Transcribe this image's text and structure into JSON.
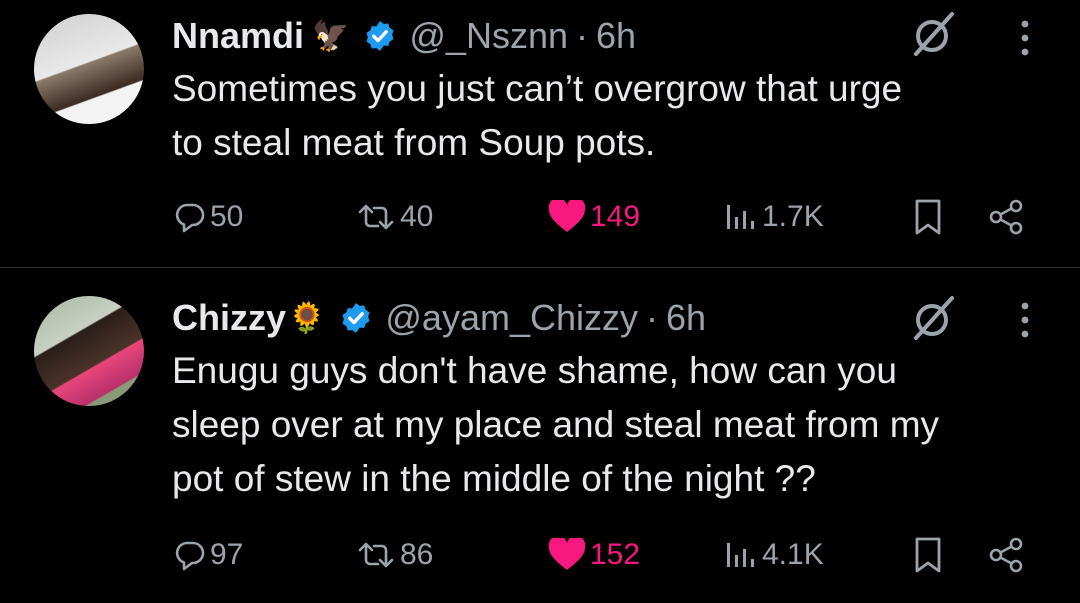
{
  "tweets": [
    {
      "name": "Nnamdi",
      "emoji": "🦅",
      "handle": "@_Nsznn",
      "separator": "·",
      "time": "6h",
      "text_lines": [
        "Sometimes you just can’t overgrow that urge",
        "to steal meat from Soup pots."
      ],
      "replies": "50",
      "retweets": "40",
      "likes": "149",
      "views": "1.7K"
    },
    {
      "name": "Chizzy",
      "emoji": "🌻",
      "handle": "@ayam_Chizzy",
      "separator": "·",
      "time": "6h",
      "text_lines": [
        "Enugu guys don't have shame, how can you",
        "sleep over at my place and steal meat from my",
        "pot of stew in the middle of the night ??"
      ],
      "replies": "97",
      "retweets": "86",
      "likes": "152",
      "views": "4.1K"
    }
  ],
  "colors": {
    "background": "#000000",
    "text": "#e7e9ea",
    "muted": "#9ba3ab",
    "like": "#f91880",
    "verified": "#1d9bf0",
    "divider": "#2f3336"
  },
  "icons": [
    "verified-badge-icon",
    "grok-icon",
    "more-icon",
    "reply-icon",
    "retweet-icon",
    "like-icon",
    "views-icon",
    "bookmark-icon",
    "share-icon"
  ]
}
